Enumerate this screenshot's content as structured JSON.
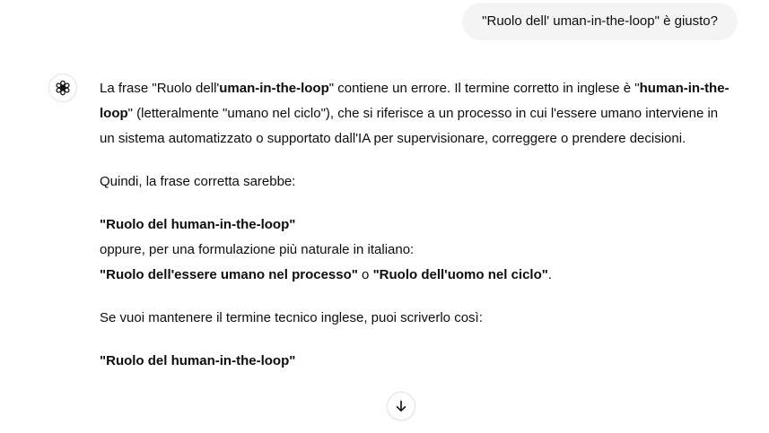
{
  "conversation": {
    "user_message": "\"Ruolo dell' uman-in-the-loop\" è giusto?",
    "assistant": {
      "avatar_icon": "openai-logo-icon",
      "p1": {
        "t1": "La frase \"Ruolo dell'",
        "b1": "uman-in-the-loop",
        "t2": "\" contiene un errore. Il termine corretto in inglese è \"",
        "b2": "human-in-the-loop",
        "t3": "\" (letteralmente \"umano nel ciclo\"), che si riferisce a un processo in cui l'essere umano interviene in un sistema automatizzato o supportato dall'IA per supervisionare, correggere o prendere decisioni."
      },
      "p2": "Quindi, la frase corretta sarebbe:",
      "p3": {
        "b1": "\"Ruolo del human-in-the-loop\"",
        "line2": "oppure, per una formulazione più naturale in italiano:",
        "b2": "\"Ruolo dell'essere umano nel processo\"",
        "t_or": " o ",
        "b3": "\"Ruolo dell'uomo nel ciclo\"",
        "t_end": "."
      },
      "p4": "Se vuoi mantenere il termine tecnico inglese, puoi scriverlo così:",
      "p5": "\"Ruolo del human-in-the-loop\""
    }
  },
  "scroll_button": {
    "icon": "arrow-down-icon"
  }
}
